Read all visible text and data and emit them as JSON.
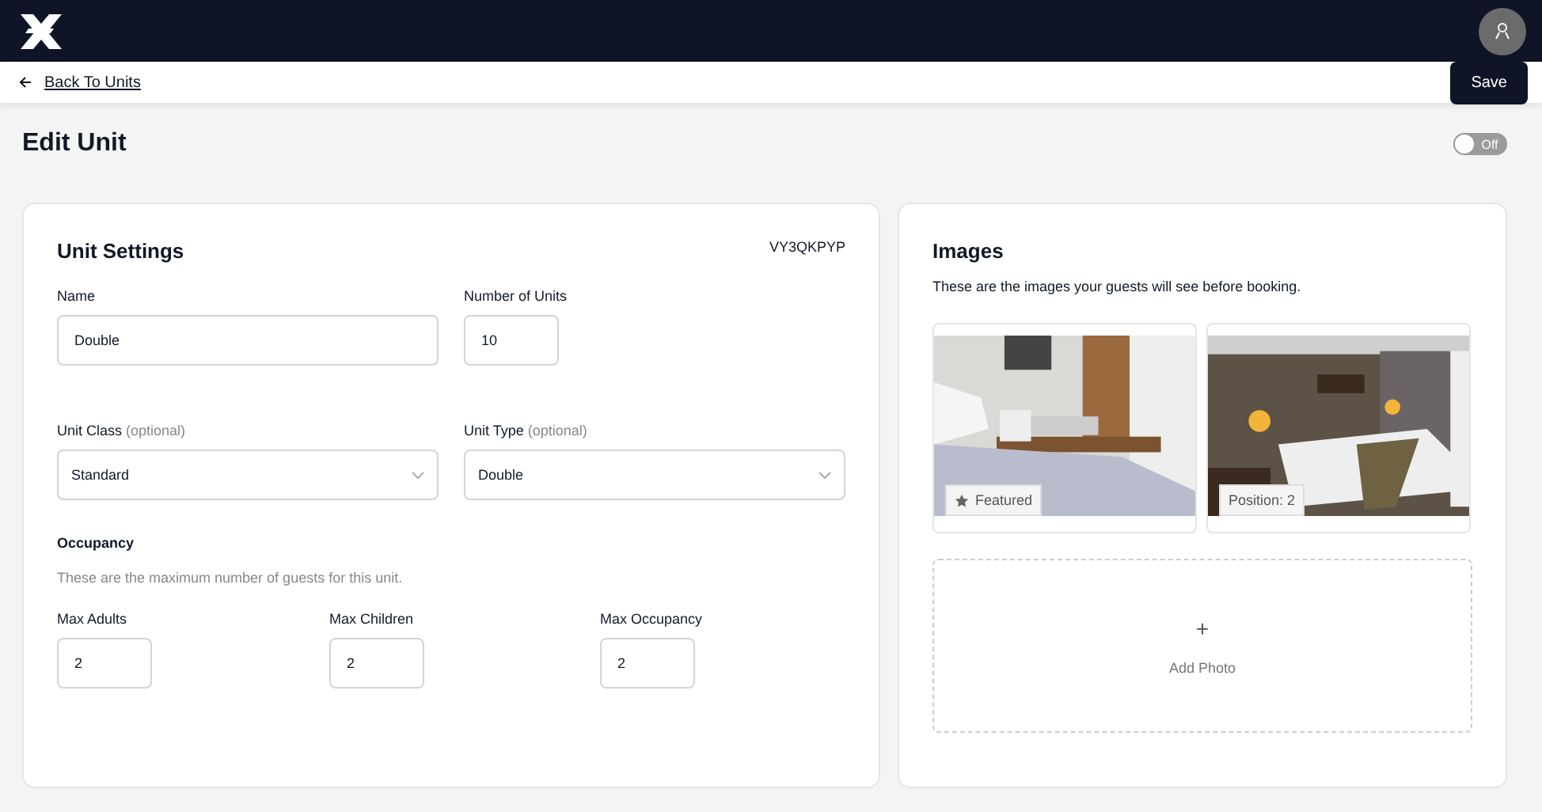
{
  "header": {
    "back_link": "Back To Units",
    "save_button": "Save"
  },
  "page": {
    "title": "Edit Unit",
    "toggle": {
      "label": "Off",
      "on": false
    }
  },
  "unit_settings": {
    "title": "Unit Settings",
    "code": "VY3QKPYP",
    "fields": [
      {
        "label": "Name",
        "value": "Double"
      },
      {
        "label": "Number of Units",
        "value": "10"
      }
    ],
    "selects": [
      {
        "label": "Unit Class",
        "hint": "(optional)",
        "value": "Standard"
      },
      {
        "label": "Unit Type",
        "hint": "(optional)",
        "value": "Double"
      }
    ],
    "occupancy": {
      "title": "Occupancy",
      "description": "These are the maximum number of guests for this unit.",
      "fields": [
        {
          "label": "Max Adults",
          "value": "2"
        },
        {
          "label": "Max Children",
          "value": "2"
        },
        {
          "label": "Max Occupancy",
          "value": "2"
        }
      ]
    }
  },
  "images": {
    "title": "Images",
    "description": "These are the images your guests will see before booking.",
    "items": [
      {
        "kind": "picture",
        "featured": true,
        "badge": "Featured"
      },
      {
        "kind": "picture",
        "featured": false,
        "badge": "Position: 2"
      }
    ],
    "add_photo": {
      "icon": "+",
      "label": "Add Photo"
    }
  }
}
